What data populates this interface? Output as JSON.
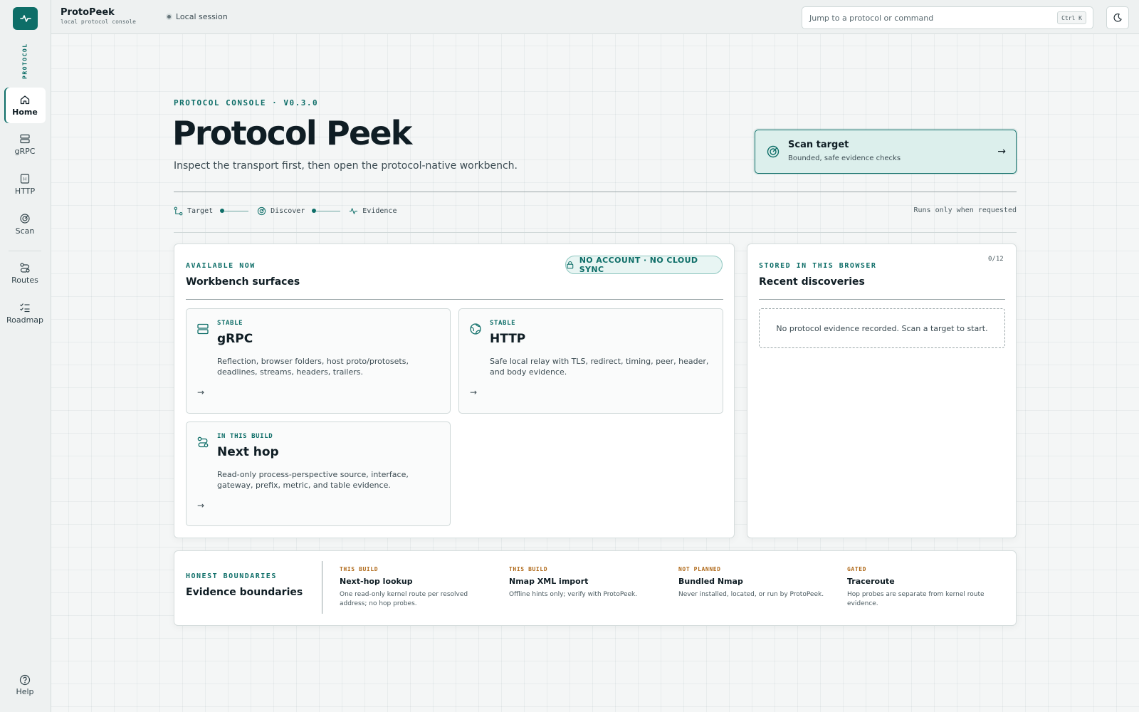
{
  "app": {
    "name": "ProtoPeek",
    "subtitle": "local protocol console",
    "session": "Local session"
  },
  "search": {
    "placeholder": "Jump to a protocol or command",
    "shortcut": "Ctrl K"
  },
  "sidebar": {
    "section_label": "PROTOCOL",
    "items": [
      {
        "label": "Home",
        "icon": "home-icon",
        "active": true
      },
      {
        "label": "gRPC",
        "icon": "server-icon"
      },
      {
        "label": "HTTP",
        "icon": "http-icon"
      },
      {
        "label": "Scan",
        "icon": "radar-icon"
      },
      {
        "label": "Routes",
        "icon": "route-icon"
      },
      {
        "label": "Roadmap",
        "icon": "checklist-icon"
      }
    ],
    "help": "Help"
  },
  "hero": {
    "eyebrow": "PROTOCOL CONSOLE · V0.3.0",
    "title": "Protocol Peek",
    "subtitle": "Inspect the transport first, then open the protocol-native workbench.",
    "cta": {
      "title": "Scan target",
      "subtitle": "Bounded, safe evidence checks"
    }
  },
  "steps": [
    "Target",
    "Discover",
    "Evidence"
  ],
  "steps_note": "Runs only when requested",
  "workbench": {
    "eyebrow": "AVAILABLE NOW",
    "title": "Workbench surfaces",
    "badge": "NO ACCOUNT · NO CLOUD SYNC",
    "surfaces": [
      {
        "tag": "STABLE",
        "name": "gRPC",
        "desc": "Reflection, browser folders, host proto/protosets, deadlines, streams, headers, trailers."
      },
      {
        "tag": "STABLE",
        "name": "HTTP",
        "desc": "Safe local relay with TLS, redirect, timing, peer, header, and body evidence."
      },
      {
        "tag": "IN THIS BUILD",
        "name": "Next hop",
        "desc": "Read-only process-perspective source, interface, gateway, prefix, metric, and table evidence."
      }
    ]
  },
  "recent": {
    "eyebrow": "STORED IN THIS BROWSER",
    "title": "Recent discoveries",
    "count": "0/12",
    "empty": "No protocol evidence recorded. Scan a target to start."
  },
  "boundaries": {
    "eyebrow": "HONEST BOUNDARIES",
    "title": "Evidence boundaries",
    "items": [
      {
        "level": "THIS BUILD",
        "title": "Next-hop lookup",
        "desc": "One read-only kernel route per resolved address; no hop probes."
      },
      {
        "level": "THIS BUILD",
        "title": "Nmap XML import",
        "desc": "Offline hints only; verify with ProtoPeek."
      },
      {
        "level": "NOT PLANNED",
        "title": "Bundled Nmap",
        "desc": "Never installed, located, or run by ProtoPeek."
      },
      {
        "level": "GATED",
        "title": "Traceroute",
        "desc": "Hop probes are separate from kernel route evidence."
      }
    ]
  },
  "colors": {
    "accent": "#0e6e68",
    "warning": "#b06a1a",
    "ink": "#0f1d24"
  }
}
